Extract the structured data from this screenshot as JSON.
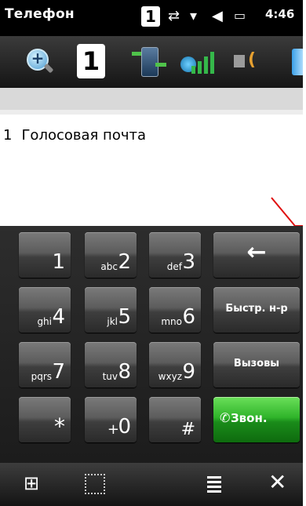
{
  "status_bar": {
    "title": "Телефон",
    "line_badge": "1",
    "time": "4:46"
  },
  "toolbar": {
    "line_number": "1"
  },
  "content": {
    "voicemail_index": "1",
    "voicemail_label": "Голосовая почта"
  },
  "keypad": {
    "keys": [
      {
        "digit": "1",
        "letters": ""
      },
      {
        "digit": "2",
        "letters": "abc"
      },
      {
        "digit": "3",
        "letters": "def"
      },
      {
        "digit": "4",
        "letters": "ghi"
      },
      {
        "digit": "5",
        "letters": "jkl"
      },
      {
        "digit": "6",
        "letters": "mno"
      },
      {
        "digit": "7",
        "letters": "pqrs"
      },
      {
        "digit": "8",
        "letters": "tuv"
      },
      {
        "digit": "9",
        "letters": "wxyz"
      },
      {
        "digit": "*",
        "letters": ""
      },
      {
        "digit": "0",
        "letters": "+"
      },
      {
        "digit": "#",
        "letters": ""
      }
    ],
    "backspace": "←",
    "speed_dial": "Быстр. н-р",
    "calls": "Вызовы",
    "call": "Звон."
  },
  "bottom_bar": {
    "close": "✕"
  },
  "colors": {
    "call_green": "#2fb42a",
    "annotation_red": "#e01010"
  },
  "icons": [
    "zoom-icon",
    "line-number-icon",
    "transfer-icon",
    "signal-icon",
    "volume-icon",
    "battery-icon",
    "windows-start-icon",
    "keyboard-icon",
    "menu-icon",
    "close-icon",
    "phone-icon"
  ]
}
